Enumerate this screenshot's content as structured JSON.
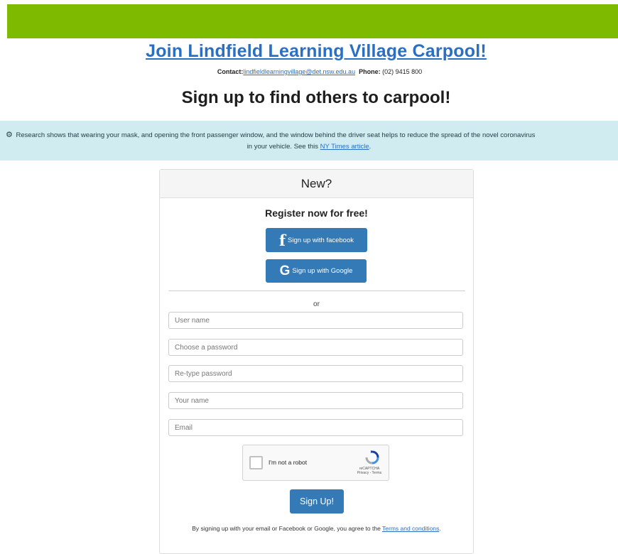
{
  "header": {
    "title": "Join Lindfield Learning Village Carpool!",
    "contact_label": "Contact:",
    "contact_email": "lindfieldlearningvillage@det.nsw.edu.au",
    "phone_label": "Phone:",
    "phone_value": "(02) 9415 800",
    "subtitle": "Sign up to find others to carpool!"
  },
  "alert": {
    "text_line1": "Research shows that wearing your mask, and opening the front passenger window, and the window behind the driver seat helps to reduce the spread of the novel coronavirus",
    "text_line2_before": "in your vehicle. See this ",
    "link_text": "NY Times article",
    "text_line2_after": ".",
    "icon": "virus-icon"
  },
  "card": {
    "header": "New?",
    "register": "Register now for free!",
    "facebook_button": "Sign up with facebook",
    "google_button": "Sign up with Google",
    "or": "or",
    "fields": {
      "username": "User name",
      "password": "Choose a password",
      "retype": "Re-type password",
      "name": "Your name",
      "email": "Email"
    },
    "captcha": {
      "label": "I'm not a robot",
      "brand": "reCAPTCHA",
      "links": "Privacy - Terms"
    },
    "signup_button": "Sign Up!",
    "terms_before": "By signing up with your email or Facebook or Google, you agree to the ",
    "terms_link": "Terms and conditions",
    "terms_after": "."
  },
  "colors": {
    "topbar": "#7dba00",
    "link": "#2a6fc4",
    "button": "#337ab7",
    "alert_bg": "#d1ecf1"
  }
}
